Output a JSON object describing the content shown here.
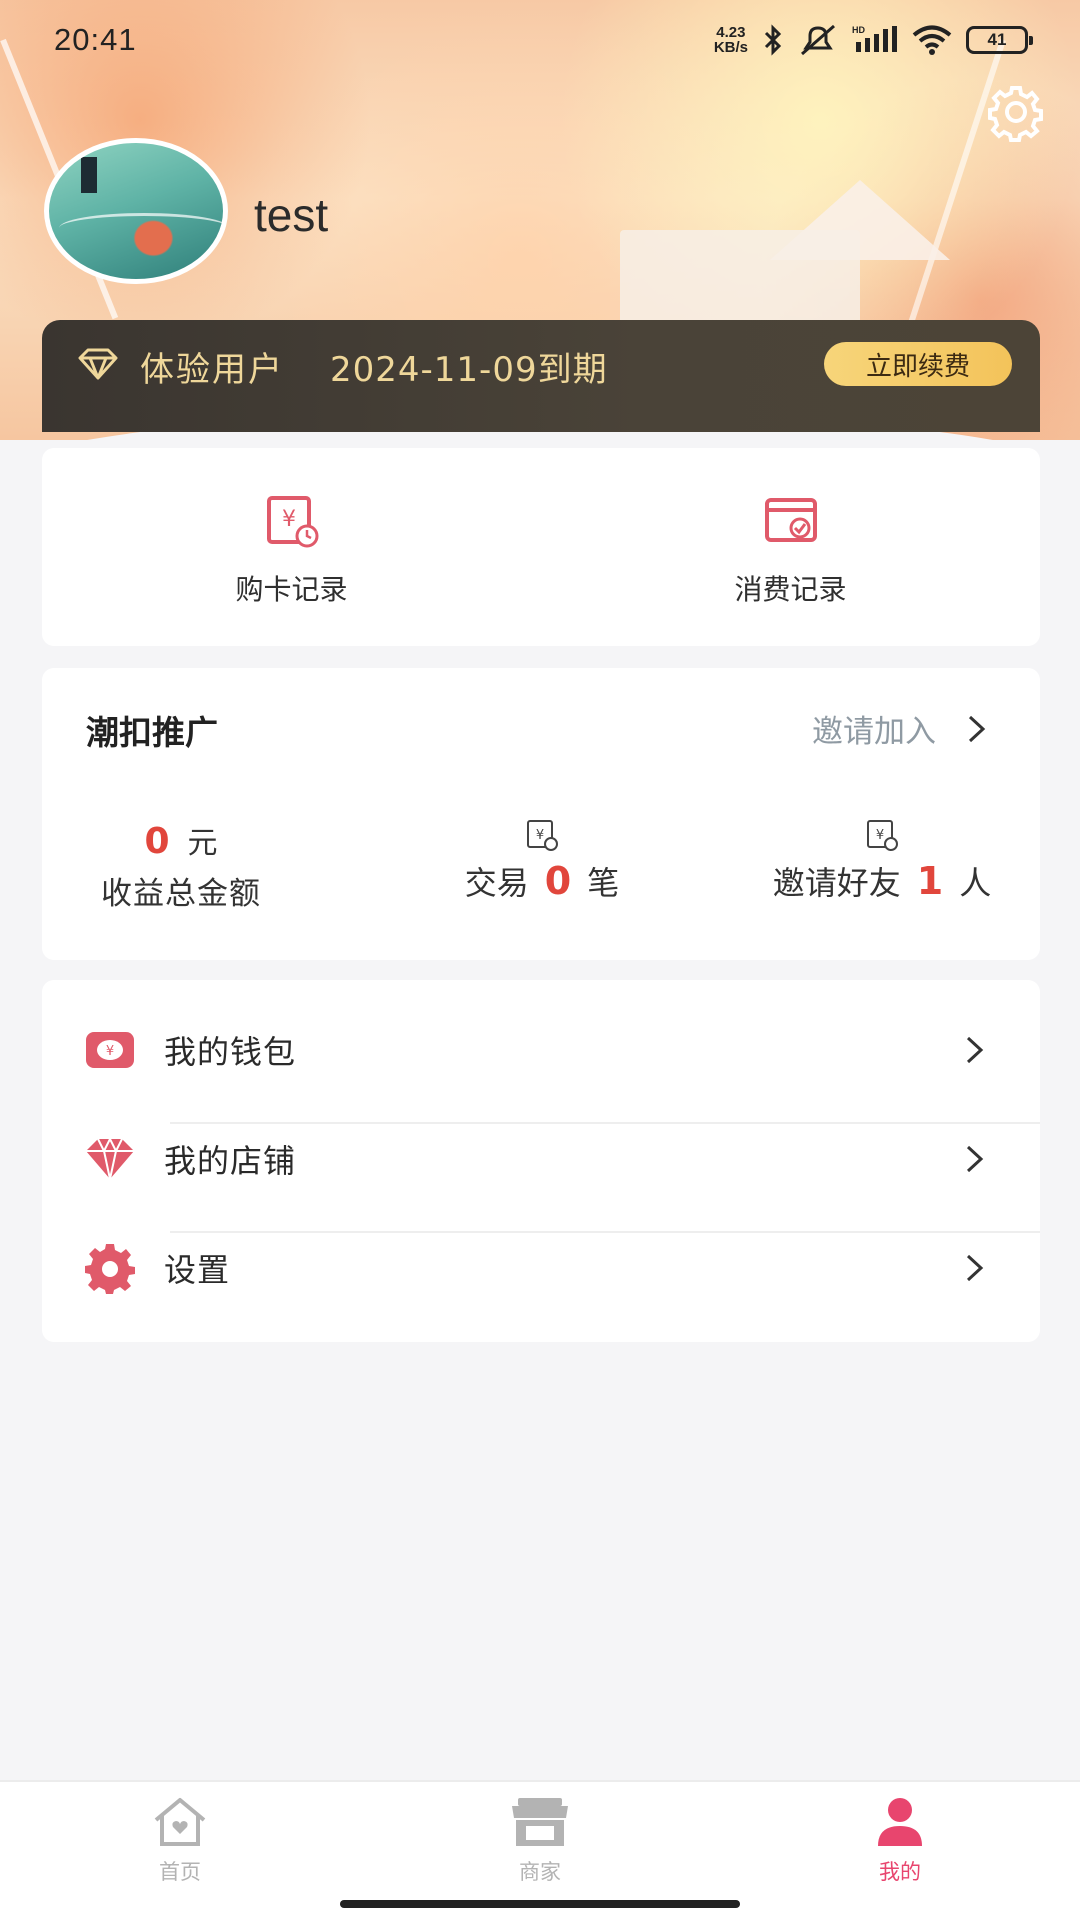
{
  "status_bar": {
    "time": "20:41",
    "net_speed_value": "4.23",
    "net_speed_unit": "KB/s",
    "network_label": "HD",
    "battery": "41"
  },
  "profile": {
    "username": "test"
  },
  "membership": {
    "level": "体验用户",
    "expiry": "2024-11-09到期",
    "renew_label": "立即续费"
  },
  "records": {
    "items": [
      {
        "label": "购卡记录",
        "icon": "card-purchase-record-icon"
      },
      {
        "label": "消费记录",
        "icon": "consumption-record-icon"
      }
    ]
  },
  "promotion": {
    "title": "潮扣推广",
    "invite_label": "邀请加入",
    "total_income_value": "0",
    "total_income_unit": "元",
    "total_income_label": "收益总金额",
    "trade_prefix": "交易",
    "trade_value": "0",
    "trade_unit": "笔",
    "invite_prefix": "邀请好友",
    "invite_value": "1",
    "invite_unit": "人"
  },
  "menu": {
    "items": [
      {
        "label": "我的钱包",
        "icon": "wallet-icon"
      },
      {
        "label": "我的店铺",
        "icon": "diamond-store-icon"
      },
      {
        "label": "设置",
        "icon": "gear-icon"
      }
    ]
  },
  "bottom_nav": {
    "items": [
      {
        "label": "首页",
        "icon": "home-icon",
        "active": false
      },
      {
        "label": "商家",
        "icon": "store-icon",
        "active": false
      },
      {
        "label": "我的",
        "icon": "user-icon",
        "active": true
      }
    ]
  },
  "colors": {
    "accent": "#e8456e",
    "number_red": "#e1463c",
    "gold": "#efd79a",
    "icon_red": "#e05a6a"
  }
}
